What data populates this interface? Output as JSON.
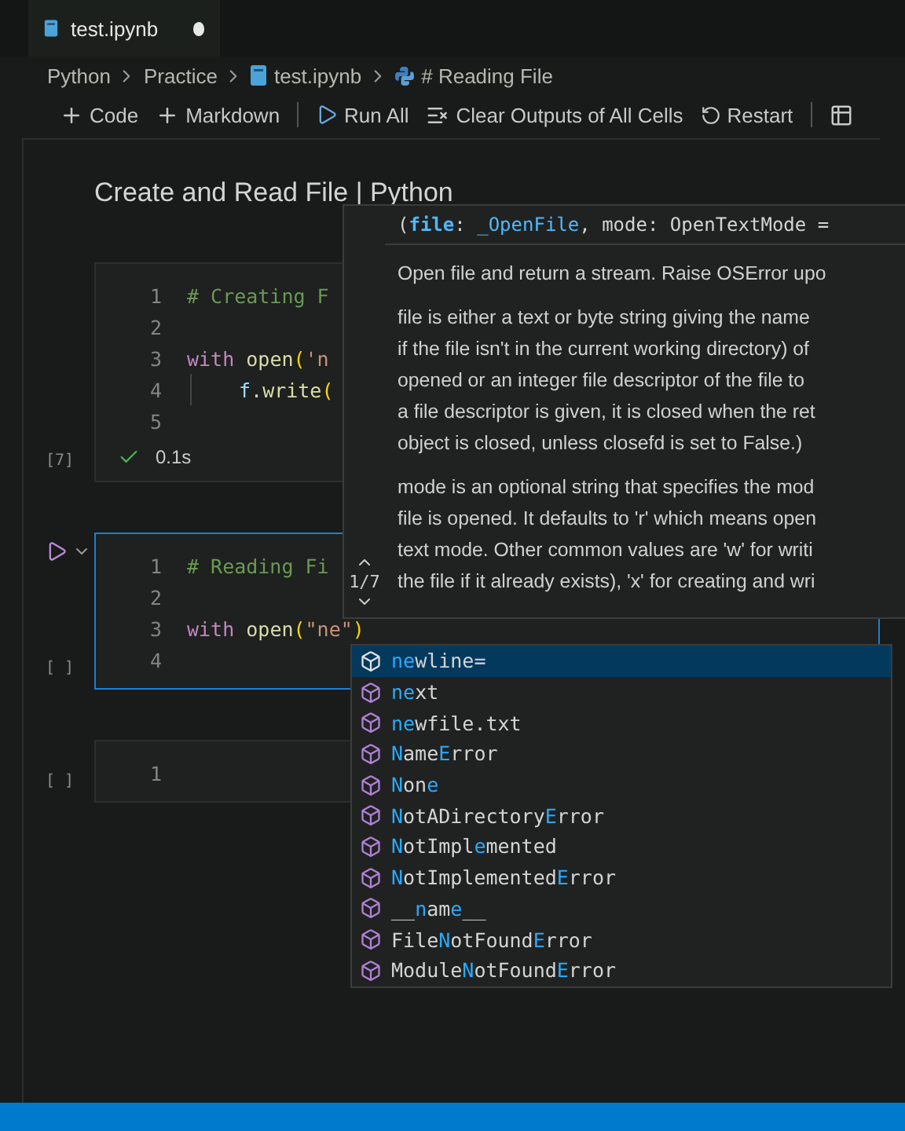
{
  "tab": {
    "label": "test.ipynb",
    "modified": true
  },
  "breadcrumbs": [
    {
      "label": "Python",
      "kind": "folder"
    },
    {
      "label": "Practice",
      "kind": "folder"
    },
    {
      "label": "test.ipynb",
      "kind": "notebook"
    },
    {
      "label": "# Reading File",
      "kind": "cell"
    }
  ],
  "toolbar": [
    {
      "label": "Code",
      "kind": "add"
    },
    {
      "label": "Markdown",
      "kind": "add"
    },
    {
      "kind": "separator"
    },
    {
      "label": "Run All",
      "kind": "run"
    },
    {
      "label": "Clear Outputs of All Cells",
      "kind": "clear"
    },
    {
      "label": "Restart",
      "kind": "restart"
    },
    {
      "kind": "separator"
    },
    {
      "kind": "variables"
    }
  ],
  "notebook": {
    "title": "Create and Read File | Python",
    "cells": [
      {
        "selected": false,
        "execution": "[7]",
        "status": {
          "time": "0.1s"
        },
        "lines": [
          {
            "number": "1",
            "tokens": [
              {
                "kind": "comment",
                "text": "# Creating F"
              }
            ]
          },
          {
            "number": "2"
          },
          {
            "number": "3",
            "tokens": [
              {
                "kind": "keyword",
                "text": "with "
              },
              {
                "kind": "func",
                "text": "open"
              },
              {
                "kind": "paren",
                "text": "("
              },
              {
                "kind": "string",
                "text": "'n"
              }
            ]
          },
          {
            "number": "4",
            "indented": true,
            "tokens": [
              {
                "kind": "variable",
                "text": "f"
              },
              {
                "kind": "plain",
                "text": "."
              },
              {
                "kind": "func",
                "text": "write"
              },
              {
                "kind": "paren",
                "text": "("
              }
            ]
          },
          {
            "number": "5"
          }
        ]
      },
      {
        "selected": true,
        "execution": "[ ]",
        "lines": [
          {
            "number": "1",
            "tokens": [
              {
                "kind": "comment",
                "text": "# Reading Fi"
              }
            ]
          },
          {
            "number": "2"
          },
          {
            "number": "3",
            "tokens": [
              {
                "kind": "keyword",
                "text": "with "
              },
              {
                "kind": "func",
                "text": "open"
              },
              {
                "kind": "paren",
                "text": "("
              },
              {
                "kind": "string",
                "text": "\"ne\""
              },
              {
                "kind": "paren",
                "text": ")"
              }
            ]
          },
          {
            "number": "4"
          }
        ]
      },
      {
        "selected": false,
        "execution": "[ ]",
        "lines": [
          {
            "number": "1"
          }
        ]
      }
    ]
  },
  "parameter_hint": {
    "signature": [
      {
        "kind": "plain",
        "text": "("
      },
      {
        "kind": "param",
        "text": "file"
      },
      {
        "kind": "plain",
        "text": ": "
      },
      {
        "kind": "type",
        "text": "_OpenFile"
      },
      {
        "kind": "plain",
        "text": ", mode: OpenTextMode ="
      }
    ],
    "counter": "1/7",
    "paragraphs": [
      [
        "Open file and return a stream. Raise OSError upo"
      ],
      [
        "file is either a text or byte string giving the name",
        "if the file isn't in the current working directory) of",
        "opened or an integer file descriptor of the file to",
        "a file descriptor is given, it is closed when the ret",
        "object is closed, unless closefd is set to False.)"
      ],
      [
        "mode is an optional string that specifies the mod",
        "file is opened. It defaults to 'r' which means open",
        "text mode. Other common values are 'w' for writi",
        "the file if it already exists), 'x' for creating and wri"
      ]
    ]
  },
  "suggestions": [
    {
      "selected": true,
      "parts": [
        {
          "text": "ne",
          "matched": true
        },
        {
          "text": "wline=",
          "matched": false
        }
      ]
    },
    {
      "selected": false,
      "parts": [
        {
          "text": "ne",
          "matched": true
        },
        {
          "text": "xt",
          "matched": false
        }
      ]
    },
    {
      "selected": false,
      "parts": [
        {
          "text": "ne",
          "matched": true
        },
        {
          "text": "wfile.txt",
          "matched": false
        }
      ]
    },
    {
      "selected": false,
      "parts": [
        {
          "text": "N",
          "matched": true
        },
        {
          "text": "ame",
          "matched": false
        },
        {
          "text": "E",
          "matched": true
        },
        {
          "text": "rror",
          "matched": false
        }
      ]
    },
    {
      "selected": false,
      "parts": [
        {
          "text": "N",
          "matched": true
        },
        {
          "text": "on",
          "matched": false
        },
        {
          "text": "e",
          "matched": true
        }
      ]
    },
    {
      "selected": false,
      "parts": [
        {
          "text": "N",
          "matched": true
        },
        {
          "text": "otADirectory",
          "matched": false
        },
        {
          "text": "E",
          "matched": true
        },
        {
          "text": "rror",
          "matched": false
        }
      ]
    },
    {
      "selected": false,
      "parts": [
        {
          "text": "N",
          "matched": true
        },
        {
          "text": "otImpl",
          "matched": false
        },
        {
          "text": "e",
          "matched": true
        },
        {
          "text": "mented",
          "matched": false
        }
      ]
    },
    {
      "selected": false,
      "parts": [
        {
          "text": "N",
          "matched": true
        },
        {
          "text": "otImplemented",
          "matched": false
        },
        {
          "text": "E",
          "matched": true
        },
        {
          "text": "rror",
          "matched": false
        }
      ]
    },
    {
      "selected": false,
      "parts": [
        {
          "text": "__",
          "matched": false
        },
        {
          "text": "n",
          "matched": true
        },
        {
          "text": "am",
          "matched": false
        },
        {
          "text": "e",
          "matched": true
        },
        {
          "text": "__",
          "matched": false
        }
      ]
    },
    {
      "selected": false,
      "parts": [
        {
          "text": "File",
          "matched": false
        },
        {
          "text": "N",
          "matched": true
        },
        {
          "text": "otFound",
          "matched": false
        },
        {
          "text": "E",
          "matched": true
        },
        {
          "text": "rror",
          "matched": false
        }
      ]
    },
    {
      "selected": false,
      "parts": [
        {
          "text": "Module",
          "matched": false
        },
        {
          "text": "N",
          "matched": true
        },
        {
          "text": "otFound",
          "matched": false
        },
        {
          "text": "E",
          "matched": true
        },
        {
          "text": "rror",
          "matched": false
        }
      ]
    }
  ]
}
